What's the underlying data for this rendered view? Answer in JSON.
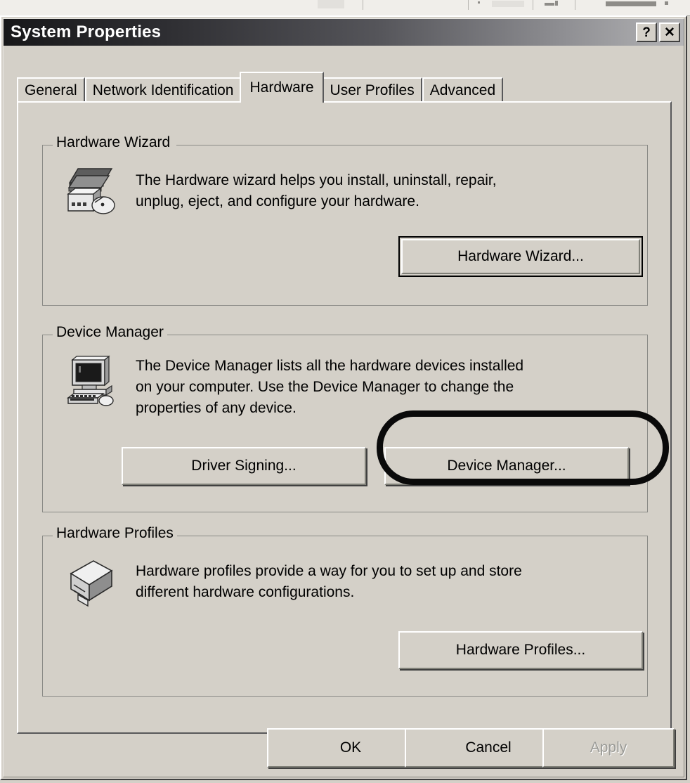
{
  "window": {
    "title": "System Properties",
    "help_button": "?",
    "close_button": "✕"
  },
  "tabs": [
    {
      "label": "General",
      "active": false
    },
    {
      "label": "Network Identification",
      "active": false
    },
    {
      "label": "Hardware",
      "active": true
    },
    {
      "label": "User Profiles",
      "active": false
    },
    {
      "label": "Advanced",
      "active": false
    }
  ],
  "groups": {
    "hardware_wizard": {
      "title": "Hardware Wizard",
      "icon": "hardware-devices-icon",
      "description": "The Hardware wizard helps you install, uninstall, repair,\nunplug, eject, and configure your hardware.",
      "button": "Hardware Wizard..."
    },
    "device_manager": {
      "title": "Device Manager",
      "icon": "computer-icon",
      "description": "The Device Manager lists all the hardware devices installed\non your computer. Use the Device Manager to change the\nproperties of any device.",
      "driver_signing_button": "Driver Signing...",
      "device_manager_button": "Device Manager..."
    },
    "hardware_profiles": {
      "title": "Hardware Profiles",
      "icon": "hardware-profile-icon",
      "description": "Hardware profiles provide a way for you to set up and store\ndifferent hardware configurations.",
      "button": "Hardware Profiles..."
    }
  },
  "footer": {
    "ok": "OK",
    "cancel": "Cancel",
    "apply": "Apply"
  },
  "annotation": {
    "shape": "rounded-rectangle-highlight",
    "target": "Device Manager...",
    "color": "#0a0a0a"
  },
  "colors": {
    "window_face": "#d4d0c8",
    "title_gradient_start": "#18181a",
    "title_gradient_end": "#b4b4b6",
    "title_text": "#ffffff",
    "disabled_text": "#9a9a96",
    "group_border": "#8a8a86"
  }
}
